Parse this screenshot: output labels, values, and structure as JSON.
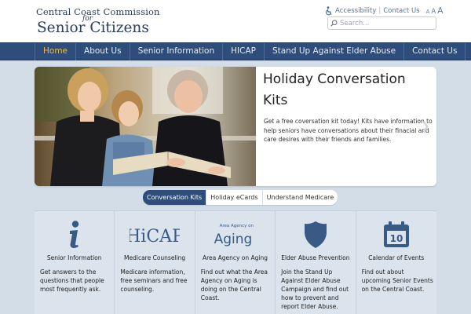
{
  "header": {
    "logo_line1": "Central Coast Commission",
    "logo_for": "for",
    "logo_line2": "Senior Citizens",
    "accessibility_label": "Accessibility",
    "contact_label": "Contact Us",
    "font_small": "A",
    "font_medium": "A",
    "font_large": "A",
    "search_placeholder": "Search..."
  },
  "nav": {
    "items": [
      {
        "label": "Home"
      },
      {
        "label": "About Us"
      },
      {
        "label": "Senior Information"
      },
      {
        "label": "HICAP"
      },
      {
        "label": "Stand Up Against Elder Abuse"
      },
      {
        "label": "Contact Us"
      }
    ]
  },
  "slider": {
    "title": "Holiday Conversation Kits",
    "text": "Get a free coversation kit today! Kits have information to help seniors have conversations about their finacial and care desires with their friends and families."
  },
  "tabs": [
    {
      "label": "Conversation Kits"
    },
    {
      "label": "Holiday eCards"
    },
    {
      "label": "Understand Medicare"
    }
  ],
  "features": [
    {
      "icon": "info-icon",
      "title": "Senior Information",
      "text": "Get answers to the questions that people most frequently ask."
    },
    {
      "icon": "hicap-logo",
      "logo_text": "HiCAP",
      "title": "Medicare Counseling",
      "text": "Medicare information, free seminars and free counseling."
    },
    {
      "icon": "aging-logo",
      "logo_small": "Area Agency on",
      "logo_text": "Aging",
      "title": "Area Agency on Aging",
      "text": "Find out what the Area Agency on Aging is doing on the Central Coast."
    },
    {
      "icon": "shield-icon",
      "title": "Elder Abuse Prevention",
      "text": "Join the Stand Up Against Elder Abuse Campaign and find out how to prevent and report Elder Abuse."
    },
    {
      "icon": "calendar-icon",
      "calendar_day": "10",
      "title": "Calendar of Events",
      "text": "Find out about upcoming Senior Events on the Central Coast."
    }
  ],
  "colors": {
    "nav_bg": "#2f4d7a",
    "nav_active": "#f0b94b",
    "brand_text": "#2b3e5e",
    "icon_blue": "#3a5a86",
    "page_bg": "#d3dde8"
  }
}
